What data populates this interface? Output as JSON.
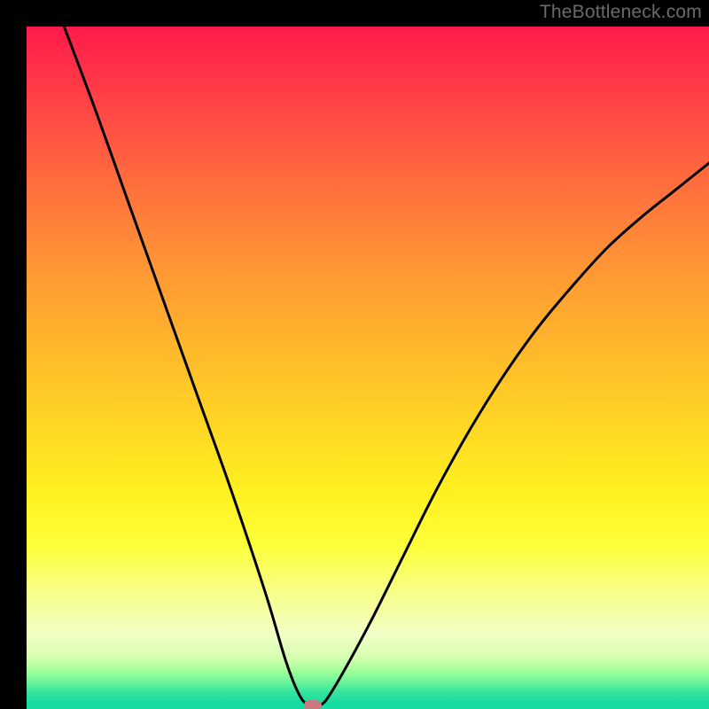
{
  "watermark": {
    "text": "TheBottleneck.com"
  },
  "chart_data": {
    "type": "line",
    "title": "",
    "xlabel": "",
    "ylabel": "",
    "xlim": [
      0,
      100
    ],
    "ylim": [
      0,
      100
    ],
    "grid": false,
    "legend": false,
    "background": {
      "kind": "vertical-gradient",
      "top_color": "#ff1a4b",
      "bottom_color": "#14dba1"
    },
    "series": [
      {
        "name": "bottleneck-curve",
        "x": [
          5.5,
          10,
          15,
          20,
          25,
          30,
          35,
          38,
          40,
          41.5,
          43,
          45,
          50,
          55,
          60,
          65,
          70,
          75,
          80,
          85,
          90,
          95,
          100
        ],
        "values": [
          100,
          88,
          74,
          60,
          46,
          32,
          17,
          7,
          2,
          0.5,
          0.5,
          3,
          12,
          22,
          32,
          41,
          49,
          56,
          62,
          67.5,
          72,
          76,
          80
        ]
      }
    ],
    "minimum_point": {
      "x": 42,
      "y": 0.5
    },
    "marker": {
      "color": "#c97a81"
    }
  }
}
